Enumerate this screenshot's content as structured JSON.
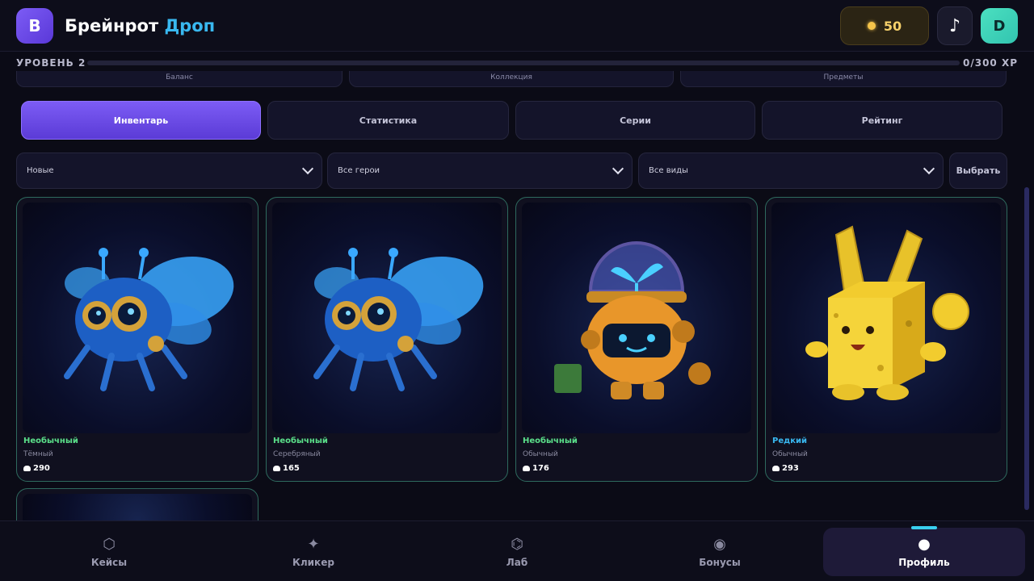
{
  "header": {
    "logo_letter": "B",
    "title_main": "Брейнрот",
    "title_accent": "Дроп",
    "coins": "50",
    "music_icon": "♪",
    "avatar_letter": "D"
  },
  "level": {
    "label": "УРОВЕНЬ 2",
    "xp_text": "0/300 XP",
    "progress_percent": 0
  },
  "stats": [
    "Баланс",
    "Коллекция",
    "Предметы"
  ],
  "tabs": [
    {
      "label": "Инвентарь",
      "active": true
    },
    {
      "label": "Статистика",
      "active": false
    },
    {
      "label": "Серии",
      "active": false
    },
    {
      "label": "Рейтинг",
      "active": false
    }
  ],
  "filters": {
    "sort": "Новые",
    "heroes": "Все герои",
    "types": "Все виды",
    "select_label": "Выбрать"
  },
  "items": [
    {
      "rarity": "Необычный",
      "rarity_color": "#5be08a",
      "variant": "Тёмный",
      "price": "290",
      "art": "bee-robot"
    },
    {
      "rarity": "Необычный",
      "rarity_color": "#5be08a",
      "variant": "Серебряный",
      "price": "165",
      "art": "bee-robot"
    },
    {
      "rarity": "Необычный",
      "rarity_color": "#5be08a",
      "variant": "Обычный",
      "price": "176",
      "art": "sprout-robot"
    },
    {
      "rarity": "Редкий",
      "rarity_color": "#39b8f0",
      "variant": "Обычный",
      "price": "293",
      "art": "cheese-bunny"
    }
  ],
  "nav": [
    {
      "label": "Кейсы",
      "icon": "⬡",
      "active": false
    },
    {
      "label": "Кликер",
      "icon": "✦",
      "active": false
    },
    {
      "label": "Лаб",
      "icon": "⌬",
      "active": false
    },
    {
      "label": "Бонусы",
      "icon": "◉",
      "active": false
    },
    {
      "label": "Профиль",
      "icon": "●",
      "active": true
    }
  ]
}
